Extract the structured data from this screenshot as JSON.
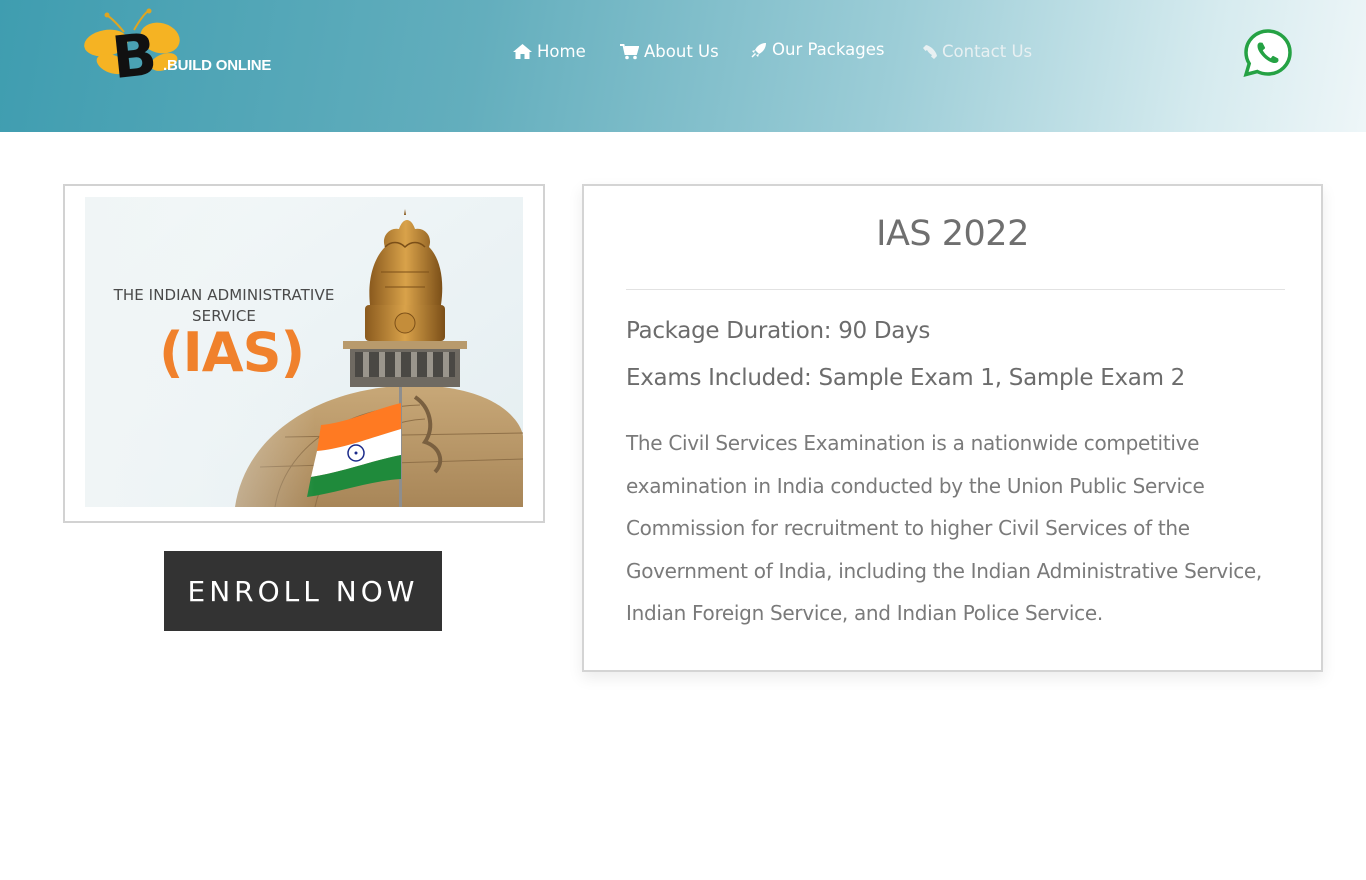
{
  "header": {
    "logo": {
      "letter": "B",
      "text": ".BUILD ONLINE"
    },
    "nav": [
      {
        "label": "Home",
        "icon": "home-icon"
      },
      {
        "label": "About Us",
        "icon": "cart-icon"
      },
      {
        "label": "Our Packages",
        "icon": "rocket-icon"
      },
      {
        "label": "Contact Us",
        "icon": "phone-icon"
      }
    ],
    "whatsapp_icon": "whatsapp-icon"
  },
  "course_image": {
    "caption": "THE INDIAN ADMINISTRATIVE SERVICE",
    "acronym": "(IAS)"
  },
  "enroll_button": {
    "label": "ENROLL NOW"
  },
  "package": {
    "title": "IAS 2022",
    "duration": "Package Duration: 90 Days",
    "exams": "Exams Included: Sample Exam 1, Sample Exam 2",
    "description": "The Civil Services Examination is a nationwide competitive examination in India conducted by the Union Public Service Commission for recruitment to higher Civil Services of the Government of India, including the Indian Administrative Service, Indian Foreign Service, and Indian Police Service."
  },
  "colors": {
    "header_start": "#3f9db0",
    "header_end": "#eef6f8",
    "logo_yellow": "#f5b323",
    "ias_orange": "#f0812c",
    "button_dark": "#333333",
    "whatsapp_green": "#25a244"
  }
}
